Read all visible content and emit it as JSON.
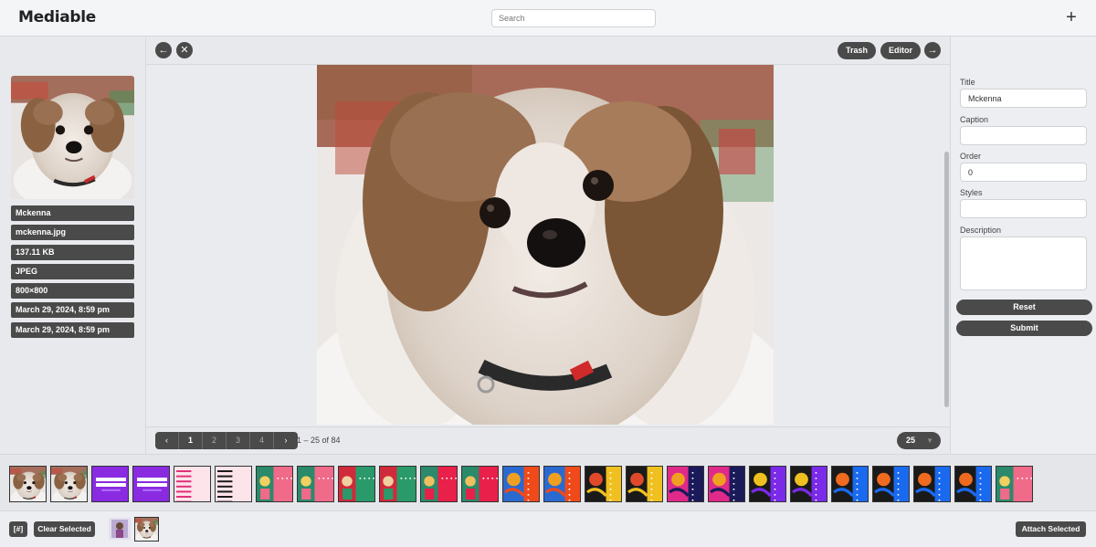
{
  "app": {
    "title": "Mediable"
  },
  "search": {
    "placeholder": "Search",
    "value": ""
  },
  "header": {
    "add_label": "+"
  },
  "toolbar": {
    "back_icon": "arrow-left-icon",
    "close_icon": "close-icon",
    "trash_label": "Trash",
    "editor_label": "Editor",
    "next_icon": "arrow-right-icon"
  },
  "file_info": {
    "items": [
      "Mckenna",
      "mckenna.jpg",
      "137.11 KB",
      "JPEG",
      "800×800",
      "March 29, 2024, 8:59 pm",
      "March 29, 2024, 8:59 pm"
    ]
  },
  "form": {
    "title_label": "Title",
    "title_value": "Mckenna",
    "caption_label": "Caption",
    "caption_value": "",
    "order_label": "Order",
    "order_value": "0",
    "styles_label": "Styles",
    "styles_value": "",
    "description_label": "Description",
    "description_value": "",
    "reset_label": "Reset",
    "submit_label": "Submit"
  },
  "pagination": {
    "prev_label": "‹",
    "pages": [
      "1",
      "2",
      "3",
      "4"
    ],
    "active_page": "1",
    "next_label": "›",
    "info": "1 – 25 of 84",
    "per_page": "25"
  },
  "strip": {
    "thumbnails": [
      "dog",
      "dog",
      "promo-purple",
      "promo-purple",
      "stripes-pink",
      "stripes-pink",
      "tiles-pink",
      "tiles-pink",
      "tiles-green",
      "tiles-green",
      "tiles-red",
      "tiles-red",
      "swirl-orange",
      "swirl-orange",
      "pattern-yellow",
      "pattern-yellow",
      "pattern-navy",
      "pattern-navy",
      "pattern-violet",
      "pattern-violet",
      "pattern-blue",
      "pattern-blue",
      "pattern-blue",
      "pattern-blue",
      "tiles-pink"
    ]
  },
  "bottom": {
    "count_label": "[#]",
    "clear_label": "Clear Selected",
    "attach_label": "Attach Selected"
  },
  "colors": {
    "button_dark": "#4a4a4a",
    "panel_bg": "#e7e9ec"
  }
}
